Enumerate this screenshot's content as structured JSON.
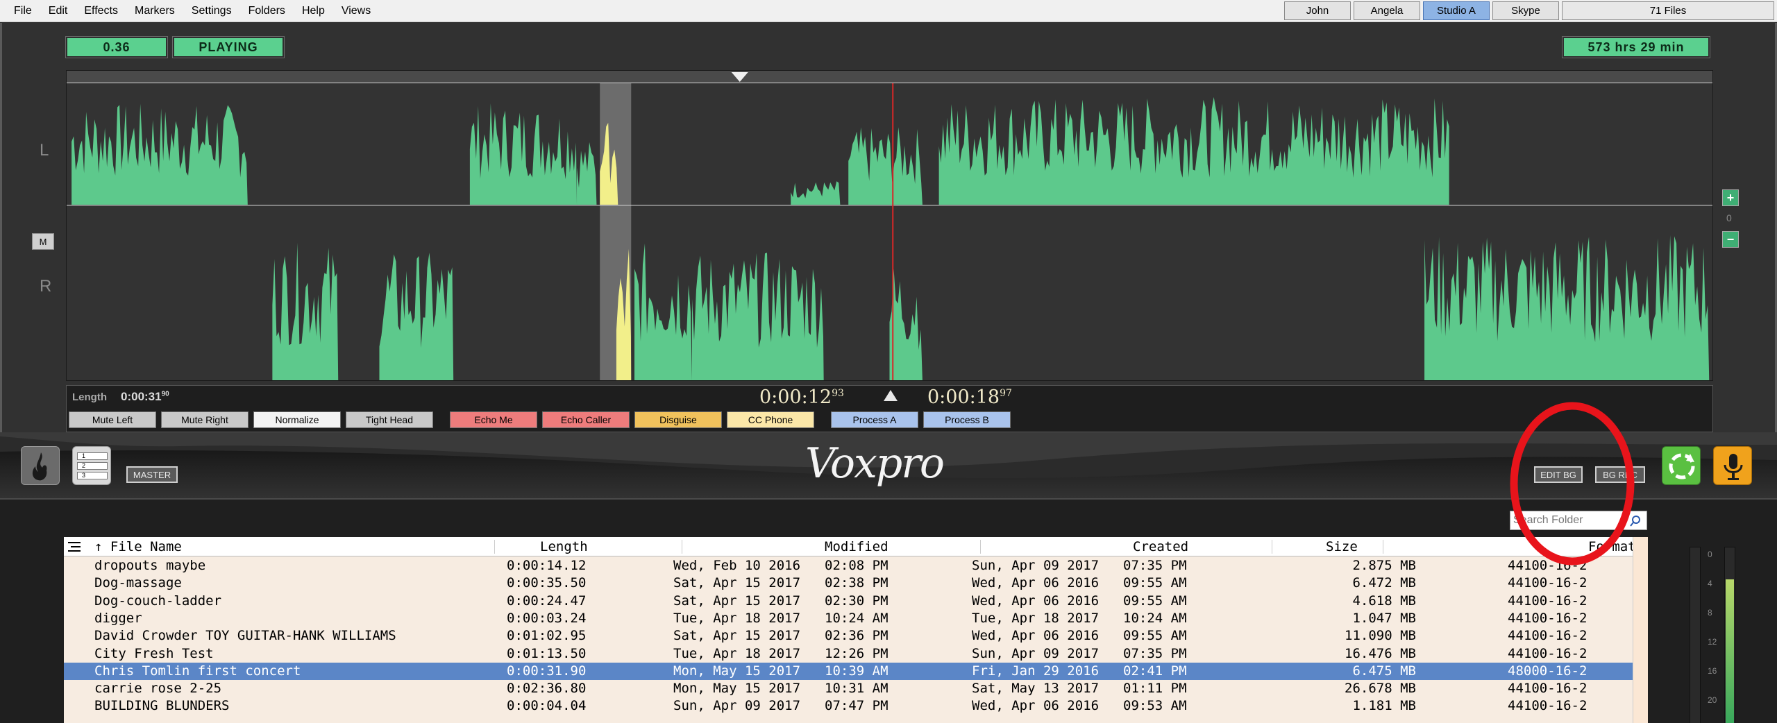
{
  "menu": [
    "File",
    "Edit",
    "Effects",
    "Markers",
    "Settings",
    "Folders",
    "Help",
    "Views"
  ],
  "user_tabs": [
    {
      "label": "John",
      "active": false
    },
    {
      "label": "Angela",
      "active": false
    },
    {
      "label": "Studio A",
      "active": true
    },
    {
      "label": "Skype",
      "active": false
    }
  ],
  "file_count": "71 Files",
  "status": {
    "position": "0.36",
    "state": "PLAYING",
    "total_time": "573 hrs 29 min"
  },
  "waveform": {
    "left_label": "L",
    "right_label": "R",
    "mono_button": "M",
    "zoom_in": "+",
    "zoom_level": "0",
    "zoom_out": "−",
    "playhead_fraction": 0.502,
    "selection_start_fraction": 0.324,
    "selection_end_fraction": 0.343,
    "wave_color": "#5dc98c",
    "selection_wave_color": "#f2ef8a"
  },
  "transport": {
    "length_label": "Length",
    "length_main": "0:00:31",
    "length_frac": "90",
    "time_left_main": "0:00:12",
    "time_left_frac": "93",
    "time_right_main": "0:00:18",
    "time_right_frac": "97"
  },
  "effects": [
    {
      "label": "Mute Left",
      "color": "#c9c9c9"
    },
    {
      "label": "Mute Right",
      "color": "#c9c9c9"
    },
    {
      "label": "Normalize",
      "color": "#f3f3f3"
    },
    {
      "label": "Tight Head",
      "color": "#c9c9c9"
    },
    {
      "label": "Echo Me",
      "color": "#ee7c7c"
    },
    {
      "label": "Echo Caller",
      "color": "#ee7c7c"
    },
    {
      "label": "Disguise",
      "color": "#f1c25c"
    },
    {
      "label": "CC Phone",
      "color": "#fbe7a8"
    },
    {
      "label": "Process A",
      "color": "#a9c3ec"
    },
    {
      "label": "Process B",
      "color": "#a9c3ec"
    }
  ],
  "middle": {
    "master_label": "MASTER",
    "logo_text": "Voxpro",
    "edit_bg": "EDIT BG",
    "bg_rec": "BG REC",
    "list_icon_lines": [
      "1",
      "2",
      "3"
    ]
  },
  "browser": {
    "search_placeholder": "Search Folder",
    "columns": [
      "↑ File Name",
      "Length",
      "Modified",
      "Created",
      "Size",
      "Format"
    ],
    "rows": [
      {
        "name": "dropouts maybe",
        "length": "0:00:14.12",
        "mod_date": "Wed, Feb 10 2016",
        "mod_time": "02:08 PM",
        "cre_date": "Sun, Apr 09 2017",
        "cre_time": "07:35 PM",
        "size": "2.875 MB",
        "format": "44100-16-2",
        "selected": false
      },
      {
        "name": "Dog-massage",
        "length": "0:00:35.50",
        "mod_date": "Sat, Apr 15 2017",
        "mod_time": "02:38 PM",
        "cre_date": "Wed, Apr 06 2016",
        "cre_time": "09:55 AM",
        "size": "6.472 MB",
        "format": "44100-16-2",
        "selected": false
      },
      {
        "name": "Dog-couch-ladder",
        "length": "0:00:24.47",
        "mod_date": "Sat, Apr 15 2017",
        "mod_time": "02:30 PM",
        "cre_date": "Wed, Apr 06 2016",
        "cre_time": "09:55 AM",
        "size": "4.618 MB",
        "format": "44100-16-2",
        "selected": false
      },
      {
        "name": "digger",
        "length": "0:00:03.24",
        "mod_date": "Tue, Apr 18 2017",
        "mod_time": "10:24 AM",
        "cre_date": "Tue, Apr 18 2017",
        "cre_time": "10:24 AM",
        "size": "1.047 MB",
        "format": "44100-16-2",
        "selected": false
      },
      {
        "name": "David Crowder TOY GUITAR-HANK WILLIAMS",
        "length": "0:01:02.95",
        "mod_date": "Sat, Apr 15 2017",
        "mod_time": "02:36 PM",
        "cre_date": "Wed, Apr 06 2016",
        "cre_time": "09:55 AM",
        "size": "11.090 MB",
        "format": "44100-16-2",
        "selected": false
      },
      {
        "name": "City Fresh Test",
        "length": "0:01:13.50",
        "mod_date": "Tue, Apr 18 2017",
        "mod_time": "12:26 PM",
        "cre_date": "Sun, Apr 09 2017",
        "cre_time": "07:35 PM",
        "size": "16.476 MB",
        "format": "44100-16-2",
        "selected": false
      },
      {
        "name": "Chris Tomlin first concert",
        "length": "0:00:31.90",
        "mod_date": "Mon, May 15 2017",
        "mod_time": "10:39 AM",
        "cre_date": "Fri, Jan 29 2016",
        "cre_time": "02:41 PM",
        "size": "6.475 MB",
        "format": "48000-16-2",
        "selected": true
      },
      {
        "name": "carrie rose 2-25",
        "length": "0:02:36.80",
        "mod_date": "Mon, May 15 2017",
        "mod_time": "10:31 AM",
        "cre_date": "Sat, May 13 2017",
        "cre_time": "01:11 PM",
        "size": "26.678 MB",
        "format": "44100-16-2",
        "selected": false
      },
      {
        "name": "BUILDING BLUNDERS",
        "length": "0:00:04.04",
        "mod_date": "Sun, Apr 09 2017",
        "mod_time": "07:47 PM",
        "cre_date": "Wed, Apr 06 2016",
        "cre_time": "09:53 AM",
        "size": "1.181 MB",
        "format": "44100-16-2",
        "selected": false
      }
    ]
  },
  "meters": {
    "scale": [
      "0",
      "4",
      "8",
      "12",
      "16",
      "20"
    ],
    "left_level": 0.0,
    "right_level": 0.82
  },
  "colors": {
    "accent_green": "#5bd08f",
    "selected_row": "#5b86c7",
    "playhead": "#d82828",
    "highlight_circle": "#e8141b"
  }
}
